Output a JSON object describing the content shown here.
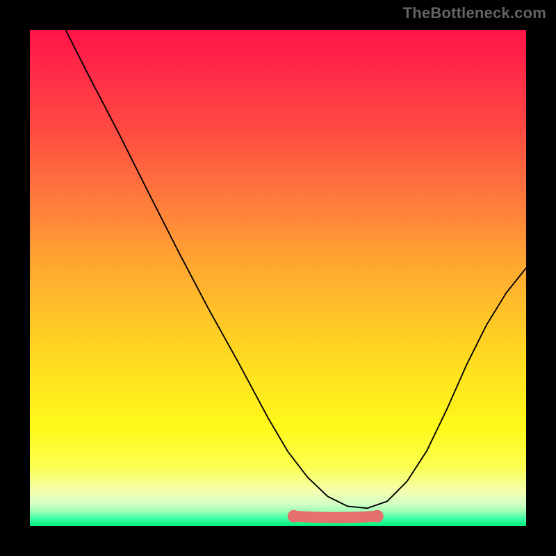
{
  "watermark": "TheBottleneck.com",
  "chart_data": {
    "type": "line",
    "title": "",
    "xlabel": "",
    "ylabel": "",
    "xlim": [
      0,
      1
    ],
    "ylim": [
      0,
      1
    ],
    "series": [
      {
        "name": "curve",
        "x": [
          0.072,
          0.12,
          0.18,
          0.24,
          0.3,
          0.36,
          0.42,
          0.48,
          0.52,
          0.56,
          0.6,
          0.64,
          0.68,
          0.72,
          0.76,
          0.8,
          0.84,
          0.88,
          0.92,
          0.96,
          1.0
        ],
        "y": [
          1.0,
          0.905,
          0.79,
          0.67,
          0.552,
          0.438,
          0.33,
          0.218,
          0.15,
          0.098,
          0.06,
          0.04,
          0.036,
          0.05,
          0.09,
          0.152,
          0.235,
          0.325,
          0.405,
          0.47,
          0.52
        ]
      },
      {
        "name": "floor-segment",
        "x": [
          0.532,
          0.7
        ],
        "y": [
          0.02,
          0.02
        ]
      }
    ],
    "gradient_stops": [
      {
        "pos": 0.0,
        "color": "#ff1448"
      },
      {
        "pos": 0.5,
        "color": "#ffb030"
      },
      {
        "pos": 0.8,
        "color": "#fff81a"
      },
      {
        "pos": 0.95,
        "color": "#d4ffc5"
      },
      {
        "pos": 1.0,
        "color": "#00f07c"
      }
    ]
  }
}
